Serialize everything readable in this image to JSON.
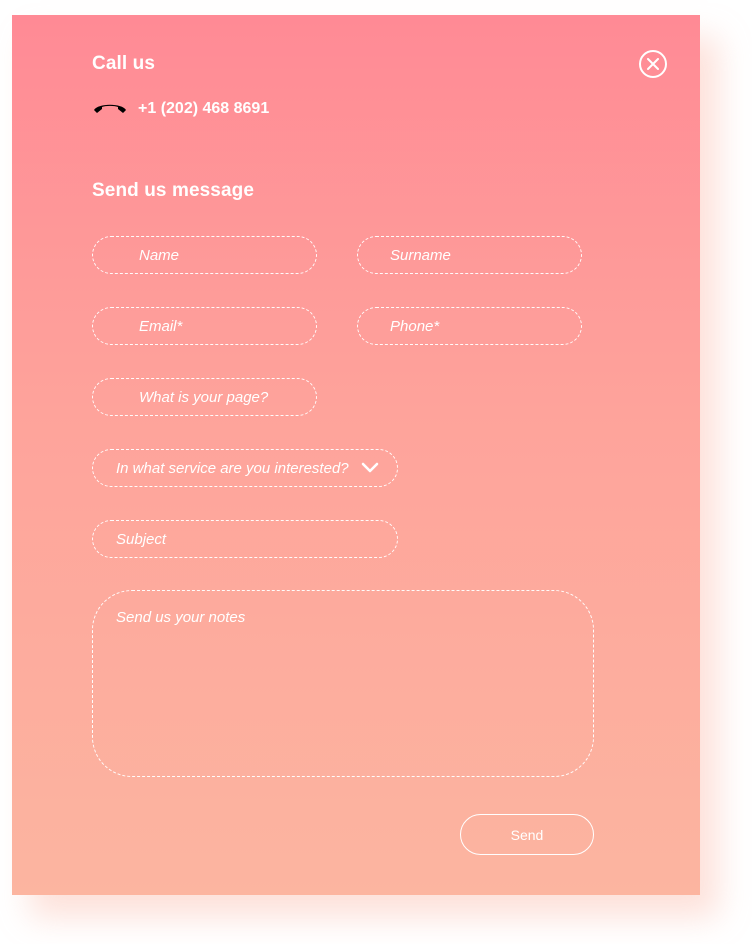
{
  "call": {
    "title": "Call us",
    "phone": "+1 (202) 468 8691"
  },
  "message": {
    "title": "Send us message"
  },
  "fields": {
    "name": "Name",
    "surname": "Surname",
    "email": "Email*",
    "phone": "Phone*",
    "page": "What is your page?",
    "service": "In what service are you interested?",
    "subject": "Subject",
    "notes": "Send us your notes"
  },
  "buttons": {
    "send": "Send"
  },
  "icons": {
    "close": "close-icon",
    "phone": "phone-handset-icon",
    "chevron": "chevron-down-icon"
  },
  "colors": {
    "gradient_top": "#ff8a95",
    "gradient_bottom": "#fcb5a0",
    "text": "#ffffff"
  }
}
